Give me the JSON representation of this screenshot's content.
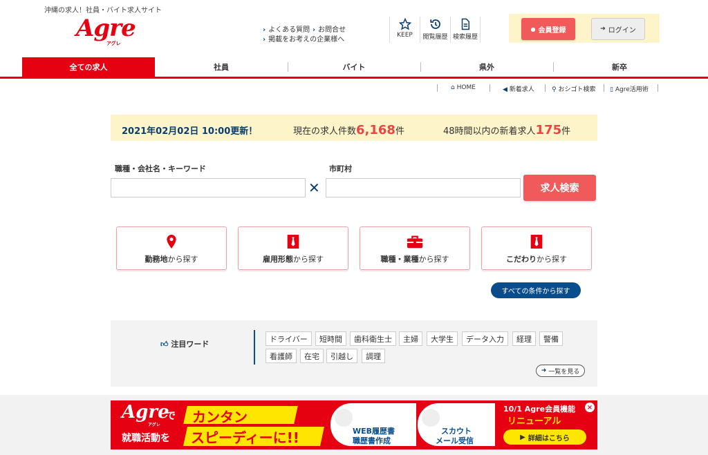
{
  "header": {
    "tagline": "沖縄の求人！社員・バイト求人サイト",
    "logo": "Agre",
    "logo_sub": "アグレ",
    "links": [
      "よくある質問",
      "お問合せ",
      "掲載をお考えの企業様へ"
    ],
    "icons": [
      {
        "label": "KEEP",
        "icon": "star-icon"
      },
      {
        "label": "閲覧履歴",
        "icon": "history-icon"
      },
      {
        "label": "検索履歴",
        "icon": "document-icon"
      }
    ],
    "register_label": "会員登録",
    "login_label": "ログイン"
  },
  "nav": {
    "tabs": [
      "全ての求人",
      "社員",
      "バイト",
      "県外",
      "新卒"
    ],
    "active": 0
  },
  "sublinks": [
    "HOME",
    "新着求人",
    "おシゴト検索",
    "Agre活用術"
  ],
  "info": {
    "updated": "2021年02月02日 10:00更新！",
    "count_prefix": "現在の求人件数",
    "count": "6,168",
    "count_suffix": "件",
    "new_prefix": "48時間以内の新着求人",
    "new_count": "175",
    "new_suffix": "件"
  },
  "search": {
    "keyword_label": "職種・会社名・キーワード",
    "keyword_value": "",
    "city_label": "市町村",
    "city_value": "",
    "submit_label": "求人検索"
  },
  "categories": [
    {
      "bold": "勤務地",
      "rest": "から探す",
      "icon": "map-pin-icon"
    },
    {
      "bold": "雇用形態",
      "rest": "から探す",
      "icon": "tie-icon"
    },
    {
      "bold": "職種・業種",
      "rest": "から探す",
      "icon": "briefcase-icon"
    },
    {
      "bold": "こだわり",
      "rest": "から探す",
      "icon": "tie-icon"
    }
  ],
  "all_conditions_label": "すべての条件から探す",
  "attention": {
    "label": "注目ワード",
    "words": [
      "ドライバー",
      "短時間",
      "歯科衛生士",
      "主婦",
      "大学生",
      "データ入力",
      "経理",
      "警備",
      "看護師",
      "在宅",
      "引越し",
      "調理"
    ],
    "list_label": "一覧を見る"
  },
  "banner": {
    "logo": "Agre",
    "logo_sub": "アグレ",
    "de": "で",
    "line2": "就職活動を",
    "kantan": "カンタン",
    "speedy": "スピーディーに!!",
    "web_resume_1": "WEB履歴書",
    "web_resume_2": "職歴書作成",
    "scout_1": "スカウト",
    "scout_2": "メール受信",
    "notice": "10/1 Agre会員機能",
    "renewal": "リニューアル",
    "detail_label": "詳細はこちら"
  },
  "colors": {
    "brand_red": "#e50012",
    "navy": "#0a3d6b",
    "highlight_yellow": "#fdf5c9",
    "accent_coral": "#f05a5a"
  }
}
